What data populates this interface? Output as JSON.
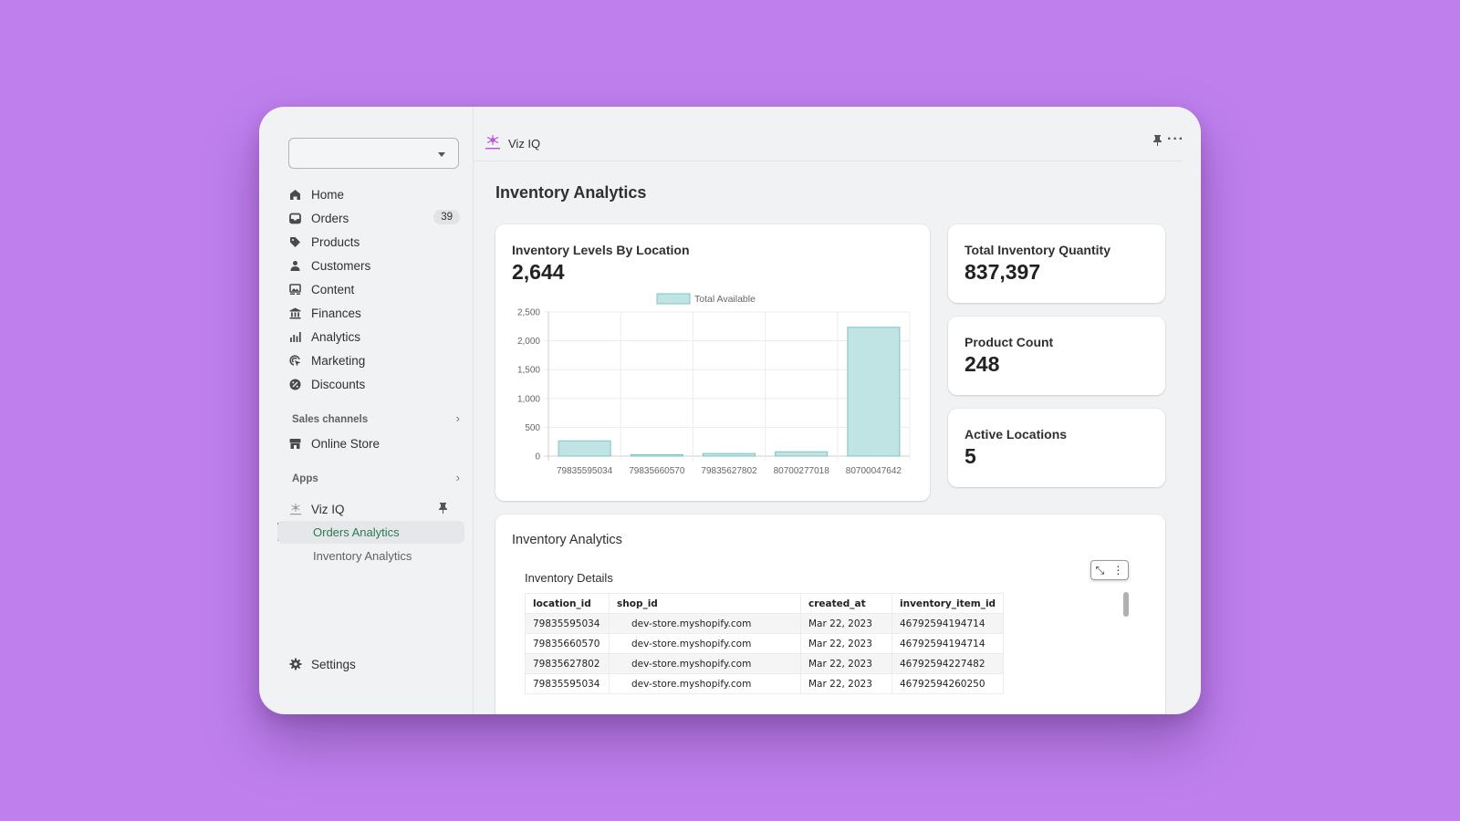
{
  "sidebar": {
    "store_select_value": "",
    "nav": [
      {
        "label": "Home",
        "icon": "home-icon"
      },
      {
        "label": "Orders",
        "icon": "inbox-icon",
        "badge": "39"
      },
      {
        "label": "Products",
        "icon": "tag-icon"
      },
      {
        "label": "Customers",
        "icon": "person-icon"
      },
      {
        "label": "Content",
        "icon": "image-icon"
      },
      {
        "label": "Finances",
        "icon": "bank-icon"
      },
      {
        "label": "Analytics",
        "icon": "bar-chart-icon"
      },
      {
        "label": "Marketing",
        "icon": "target-icon"
      },
      {
        "label": "Discounts",
        "icon": "percent-icon"
      }
    ],
    "sales_channels_label": "Sales channels",
    "online_store_label": "Online Store",
    "apps_label": "Apps",
    "app_name": "Viz IQ",
    "app_subitems": [
      {
        "label": "Orders Analytics",
        "active": true
      },
      {
        "label": "Inventory Analytics",
        "active": false
      }
    ],
    "settings_label": "Settings"
  },
  "topbar": {
    "app_name": "Viz IQ"
  },
  "page_title": "Inventory Analytics",
  "chart_card": {
    "title": "Inventory Levels By Location",
    "value": "2,644"
  },
  "kpis": [
    {
      "title": "Total Inventory Quantity",
      "value": "837,397"
    },
    {
      "title": "Product Count",
      "value": "248"
    },
    {
      "title": "Active Locations",
      "value": "5"
    }
  ],
  "chart_data": {
    "type": "bar",
    "title": "Inventory Levels By Location",
    "categories": [
      "79835595034",
      "79835660570",
      "79835627802",
      "80700277018",
      "80700047642"
    ],
    "series": [
      {
        "name": "Total Available",
        "values": [
          265,
          25,
          45,
          75,
          2234
        ]
      }
    ],
    "xlabel": "",
    "ylabel": "",
    "ylim": [
      0,
      2500
    ],
    "yticks": [
      0,
      500,
      1000,
      1500,
      2000,
      2500
    ],
    "ytick_labels": [
      "0",
      "500",
      "1,000",
      "1,500",
      "2,000",
      "2,500"
    ],
    "grid": true,
    "legend": "top-center",
    "colors": {
      "fill": "#c0e4e4",
      "stroke": "#7cc4c4"
    }
  },
  "table_card": {
    "title": "Inventory Analytics",
    "subtitle": "Inventory Details",
    "columns": [
      "location_id",
      "shop_id",
      "created_at",
      "inventory_item_id"
    ],
    "rows": [
      [
        "79835595034",
        "dev-store.myshopify.com",
        "Mar 22, 2023",
        "46792594194714"
      ],
      [
        "79835660570",
        "dev-store.myshopify.com",
        "Mar 22, 2023",
        "46792594194714"
      ],
      [
        "79835627802",
        "dev-store.myshopify.com",
        "Mar 22, 2023",
        "46792594227482"
      ],
      [
        "79835595034",
        "dev-store.myshopify.com",
        "Mar 22, 2023",
        "46792594260250"
      ]
    ]
  },
  "colors": {
    "background": "#bf80ee",
    "active_nav": "#2a7a52",
    "accent_logo": "#b44fe0"
  }
}
